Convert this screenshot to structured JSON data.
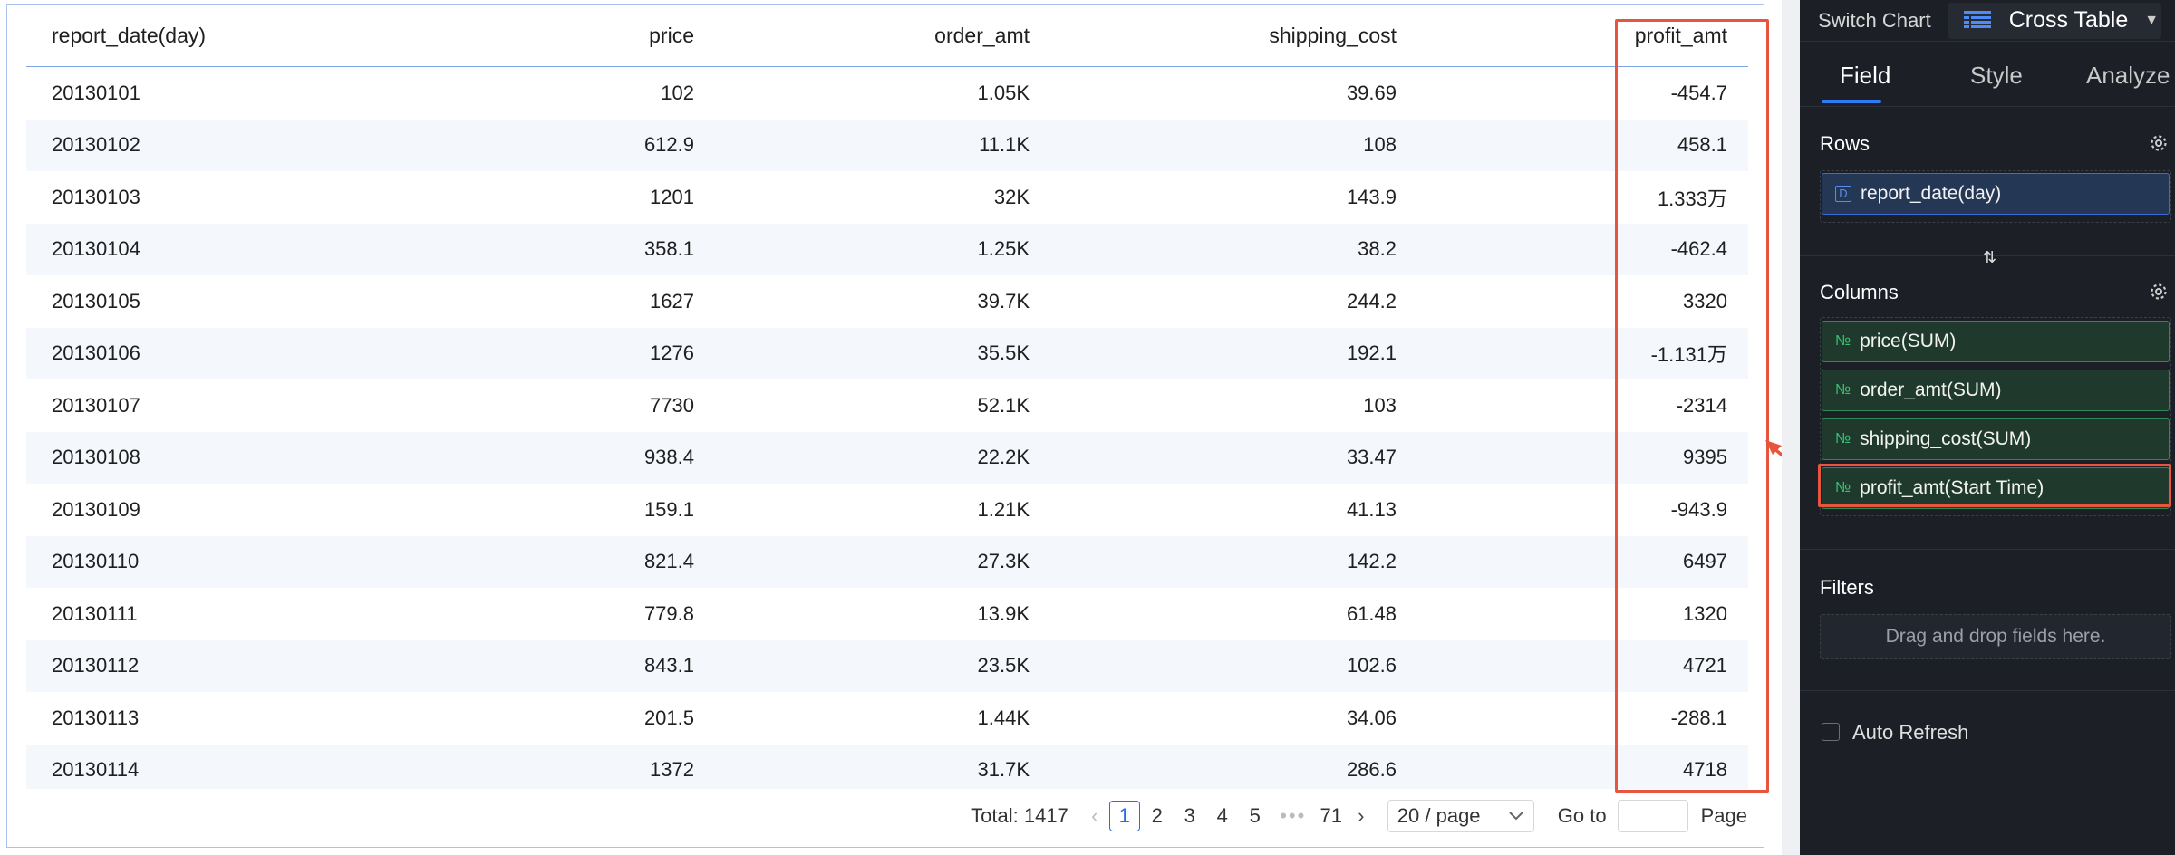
{
  "table": {
    "headers": [
      "report_date(day)",
      "price",
      "order_amt",
      "shipping_cost",
      "profit_amt"
    ],
    "rows": [
      [
        "20130101",
        "102",
        "1.05K",
        "39.69",
        "-454.7"
      ],
      [
        "20130102",
        "612.9",
        "11.1K",
        "108",
        "458.1"
      ],
      [
        "20130103",
        "1201",
        "32K",
        "143.9",
        "1.333万"
      ],
      [
        "20130104",
        "358.1",
        "1.25K",
        "38.2",
        "-462.4"
      ],
      [
        "20130105",
        "1627",
        "39.7K",
        "244.2",
        "3320"
      ],
      [
        "20130106",
        "1276",
        "35.5K",
        "192.1",
        "-1.131万"
      ],
      [
        "20130107",
        "7730",
        "52.1K",
        "103",
        "-2314"
      ],
      [
        "20130108",
        "938.4",
        "22.2K",
        "33.47",
        "9395"
      ],
      [
        "20130109",
        "159.1",
        "1.21K",
        "41.13",
        "-943.9"
      ],
      [
        "20130110",
        "821.4",
        "27.3K",
        "142.2",
        "6497"
      ],
      [
        "20130111",
        "779.8",
        "13.9K",
        "61.48",
        "1320"
      ],
      [
        "20130112",
        "843.1",
        "23.5K",
        "102.6",
        "4721"
      ],
      [
        "20130113",
        "201.5",
        "1.44K",
        "34.06",
        "-288.1"
      ],
      [
        "20130114",
        "1372",
        "31.7K",
        "286.6",
        "4718"
      ]
    ]
  },
  "pagination": {
    "total": "Total: 1417",
    "pages": [
      "1",
      "2",
      "3",
      "4",
      "5"
    ],
    "ellipsis": "•••",
    "last_page": "71",
    "page_size": "20 / page",
    "goto_label": "Go to",
    "page_label": "Page"
  },
  "sidebar": {
    "switch_chart": "Switch Chart",
    "chart_type": "Cross Table",
    "tabs": [
      "Field",
      "Style",
      "Analyze"
    ],
    "rows_title": "Rows",
    "rows_fields": [
      {
        "icon": "D",
        "label": "report_date(day)"
      }
    ],
    "columns_title": "Columns",
    "columns_fields": [
      {
        "icon": "№",
        "label": "price(SUM)"
      },
      {
        "icon": "№",
        "label": "order_amt(SUM)"
      },
      {
        "icon": "№",
        "label": "shipping_cost(SUM)"
      },
      {
        "icon": "№",
        "label": "profit_amt(Start Time)"
      }
    ],
    "filters_title": "Filters",
    "filters_hint": "Drag and drop fields here.",
    "auto_refresh": "Auto Refresh"
  },
  "colors": {
    "highlight": "#e8553f",
    "accent": "#2f7bf6",
    "measure_field": "#2f8a55",
    "dimension_field": "#3a6cd8"
  }
}
